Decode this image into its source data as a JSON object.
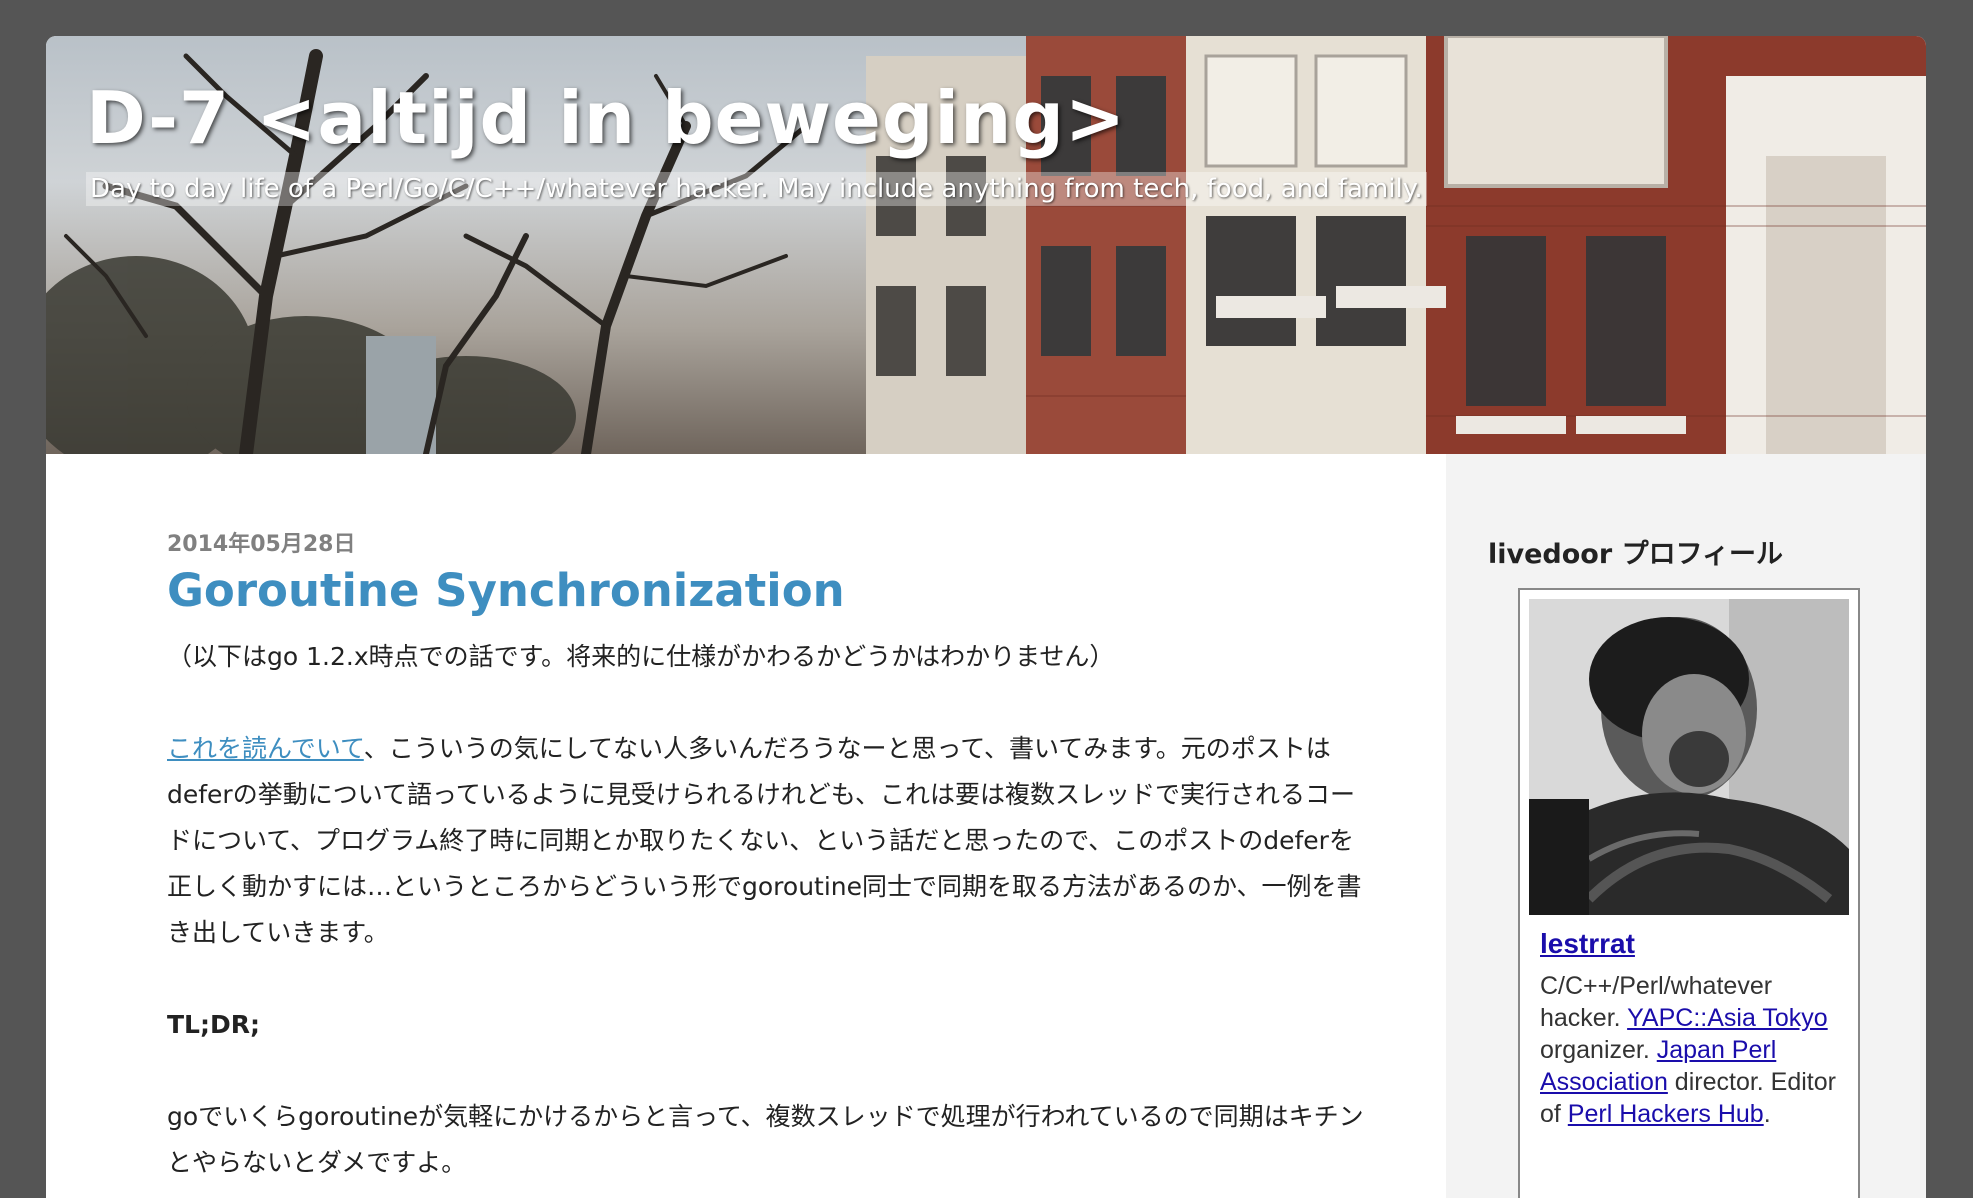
{
  "header": {
    "title": "D-7 <altijd in beweging>",
    "description": "Day to day life of a Perl/Go/C/C++/whatever hacker. May include anything from tech, food, and family."
  },
  "post": {
    "date": "2014年05月28日",
    "title": "Goroutine Synchronization",
    "intro": "（以下はgo 1.2.x時点での話です。将来的に仕様がかわるかどうかはわかりません）",
    "link_text": "これを読んでいて",
    "para1_after_link": "、こういうの気にしてない人多いんだろうなーと思って、書いてみます。元のポストはdeferの挙動について語っているように見受けられるけれども、これは要は複数スレッドで実行されるコードについて、プログラム終了時に同期とか取りたくない、という話だと思ったので、このポストのdeferを正しく動かすには…というところからどういう形でgoroutine同士で同期を取る方法があるのか、一例を書き出していきます。",
    "tldr": "TL;DR;",
    "para2": "goでいくらgoroutineが気軽にかけるからと言って、複数スレッドで処理が行われているので同期はキチンとやらないとダメですよ。"
  },
  "sidebar": {
    "widget_title": "livedoor プロフィール",
    "profile": {
      "name": "lestrrat",
      "bio_1": "C/C++/Perl/whatever hacker. ",
      "link_yapc": "YAPC::Asia Tokyo",
      "bio_2": " organizer. ",
      "link_jpa": "Japan Perl Association",
      "bio_3": " director. Editor of ",
      "link_hub": "Perl Hackers Hub",
      "bio_4": "."
    }
  },
  "colors": {
    "page_background": "#555555",
    "post_title": "#3e8ec0",
    "link": "#3e8ec0",
    "sidebar_link": "#1a0dab",
    "date": "#808080",
    "sidebar_background": "#f3f3f3"
  }
}
